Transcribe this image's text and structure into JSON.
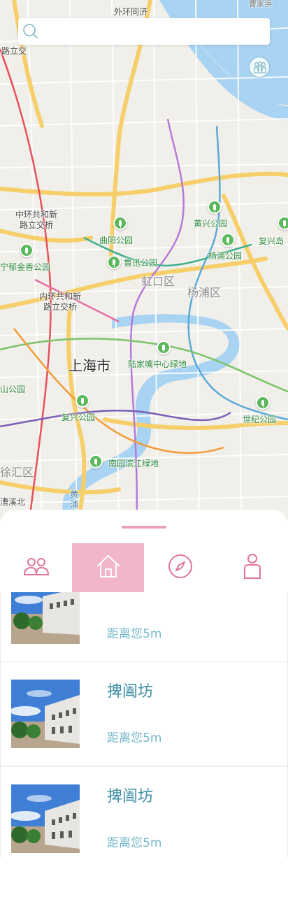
{
  "search": {
    "placeholder": "",
    "value": ""
  },
  "map": {
    "labels": {
      "top_road": "外环同济",
      "top_right": "曹家浜",
      "left_top_road": "路立交",
      "interchange_1": "中环共和新\n路立交桥",
      "interchange_2": "内环共和新\n路立交桥",
      "park_quyang": "曲阳公园",
      "park_huangxing": "黄兴公园",
      "park_fuxing_east": "复兴岛",
      "park_luxun": "鲁迅公园",
      "park_yangpu": "杨浦公园",
      "park_yujinxiang": "宁郁金香公园",
      "district_hongkou": "虹口区",
      "district_yangpu": "杨浦区",
      "city": "上海市",
      "park_lujiazui": "陆家嘴中心绿地",
      "park_shan": "山公园",
      "park_fuxing": "复兴公园",
      "park_century": "世纪公园",
      "park_nanyuan": "南园滨江绿地",
      "district_xuhui": "徐汇区",
      "road_caoxi": "漕溪北",
      "road_huangpu": "黄\n浦"
    }
  },
  "tabs": [
    {
      "id": "friends",
      "icon": "friends-icon"
    },
    {
      "id": "home",
      "icon": "home-icon",
      "active": true
    },
    {
      "id": "discover",
      "icon": "compass-icon"
    },
    {
      "id": "profile",
      "icon": "person-icon"
    }
  ],
  "places": [
    {
      "name": "",
      "distance": "距离您5m"
    },
    {
      "name": "捭阖坊",
      "distance": "距离您5m"
    },
    {
      "name": "捭阖坊",
      "distance": "距离您5m"
    }
  ],
  "colors": {
    "accent_pink": "#e0759a",
    "tab_active_bg": "#f2b6c9",
    "text_teal": "#3e8fa6"
  }
}
